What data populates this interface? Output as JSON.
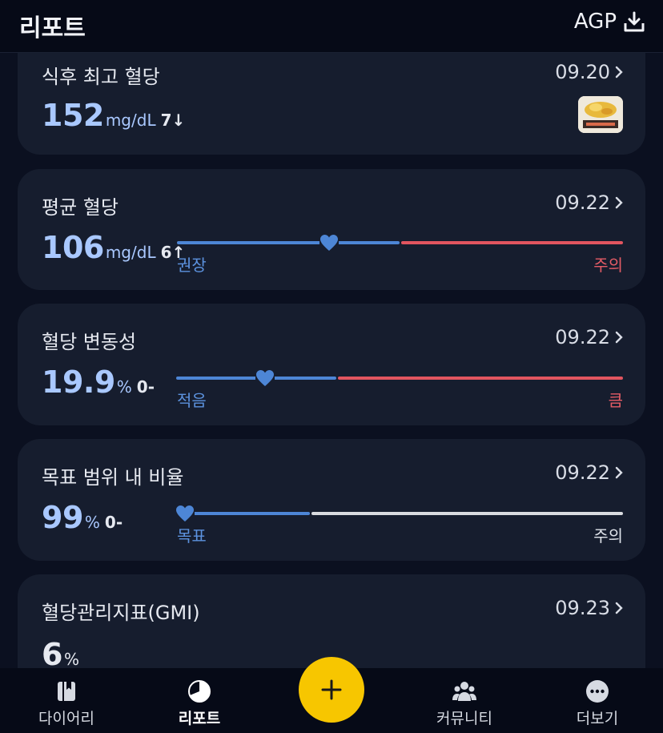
{
  "header": {
    "title": "리포트",
    "agp_label": "AGP"
  },
  "cards": {
    "postmeal": {
      "title": "식후 최고 혈당",
      "date": "09.20",
      "value": "152",
      "unit": "mg/dL",
      "delta": "7↓"
    },
    "average": {
      "title": "평균 혈당",
      "date": "09.22",
      "value": "106",
      "unit": "mg/dL",
      "delta": "6↑",
      "low_label": "권장",
      "high_label": "주의",
      "marker_fraction": 0.34
    },
    "variability": {
      "title": "혈당 변동성",
      "date": "09.22",
      "value": "19.9",
      "unit": "%",
      "delta": "0-",
      "low_label": "적음",
      "high_label": "큼",
      "marker_fraction": 0.2
    },
    "tir": {
      "title": "목표 범위 내 비율",
      "date": "09.22",
      "value": "99",
      "unit": "%",
      "delta": "0-",
      "low_label": "목표",
      "high_label": "주의",
      "marker_fraction": 0.0
    },
    "gmi": {
      "title": "혈당관리지표(GMI)",
      "date": "09.23",
      "value": "6",
      "unit": "%"
    }
  },
  "nav": {
    "diary": "다이어리",
    "report": "리포트",
    "community": "커뮤니티",
    "more": "더보기"
  },
  "colors": {
    "accent_blue": "#4d86d6",
    "warning_red": "#e2555f",
    "fab_yellow": "#f7c600"
  },
  "icons": [
    "download-icon",
    "chevron-right-icon",
    "heart-icon",
    "diary-icon",
    "report-icon",
    "plus-icon",
    "community-icon",
    "more-icon"
  ]
}
